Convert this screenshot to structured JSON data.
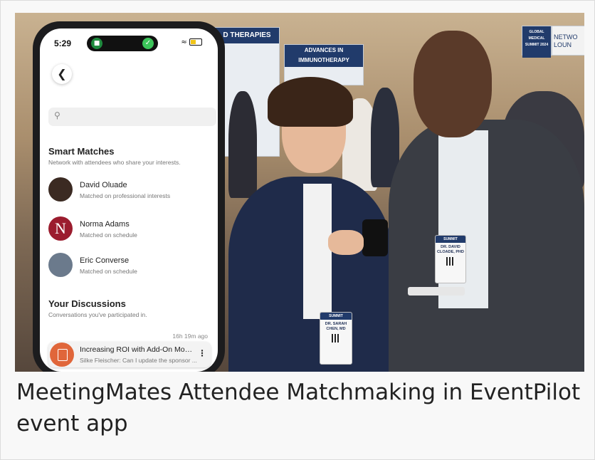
{
  "caption": "MeetingMates Attendee Matchmaking in EventPilot event app",
  "background": {
    "banner_left": "D THERAPIES",
    "banner_center": "ADVANCES IN IMMUNOTHERAPY",
    "banner_right": "GLOBAL MEDICAL SUMMIT 2024",
    "banner_far_right": "NETWO LOUN"
  },
  "badges": {
    "woman": "DR. SARAH CHEN, MD",
    "man": "DR. DAVID CLOADE, PHD"
  },
  "phone": {
    "status": {
      "time": "5:29"
    },
    "search_placeholder": "",
    "smart_matches": {
      "title": "Smart Matches",
      "subtitle": "Network with attendees who share your interests.",
      "items": [
        {
          "name": "David Oluade",
          "reason": "Matched on professional interests",
          "avatar_color": "#3b2a22"
        },
        {
          "name": "Norma Adams",
          "reason": "Matched on schedule",
          "avatar_color": "#9b1c2e"
        },
        {
          "name": "Eric Converse",
          "reason": "Matched on schedule",
          "avatar_color": "#6b7a8c"
        }
      ]
    },
    "discussions": {
      "title": "Your Discussions",
      "subtitle": "Conversations you've participated in.",
      "timestamp": "16h 19m ago",
      "item": {
        "title": "Increasing ROI with Add-On Mod...",
        "preview": "Silke Fleischer: Can I update the sponsor ...",
        "icon": "document-icon",
        "icon_color": "#e0663a"
      }
    }
  }
}
